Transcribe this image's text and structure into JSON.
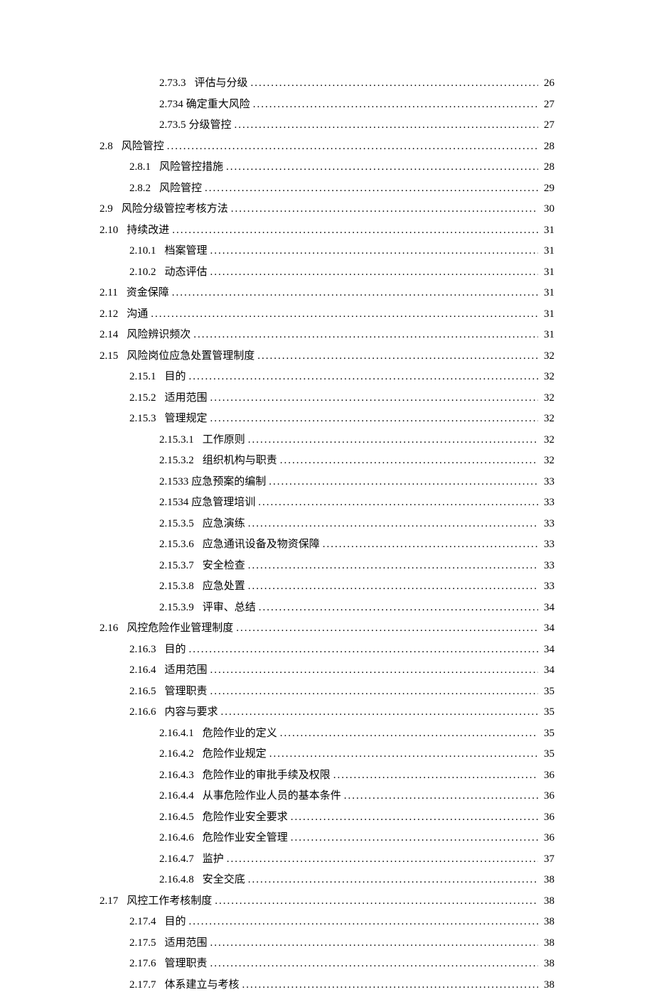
{
  "toc": [
    {
      "indent": 2,
      "num": "2.73.3",
      "title": "评估与分级",
      "page": "26"
    },
    {
      "indent": 2,
      "num": "2.734",
      "title": "确定重大风险",
      "nospace": true,
      "page": "27"
    },
    {
      "indent": 2,
      "num": "2.73.5",
      "title": "分级管控",
      "nospace": true,
      "page": "27"
    },
    {
      "indent": 0,
      "num": "2.8",
      "title": "风险管控",
      "page": "28"
    },
    {
      "indent": 1,
      "num": "2.8.1",
      "title": "风险管控措施",
      "page": "28"
    },
    {
      "indent": 1,
      "num": "2.8.2",
      "title": "风险管控",
      "page": "29"
    },
    {
      "indent": 0,
      "num": "2.9",
      "title": "风险分级管控考核方法",
      "page": "30"
    },
    {
      "indent": 0,
      "num": "2.10",
      "title": "持续改进",
      "page": "31"
    },
    {
      "indent": 1,
      "num": "2.10.1",
      "title": "档案管理",
      "page": "31"
    },
    {
      "indent": 1,
      "num": "2.10.2",
      "title": "动态评估",
      "page": "31"
    },
    {
      "indent": 0,
      "num": "2.11",
      "title": "资金保障",
      "page": "31"
    },
    {
      "indent": 0,
      "num": "2.12",
      "title": "沟通",
      "page": "31"
    },
    {
      "indent": 0,
      "num": "2.14",
      "title": "风险辨识频次",
      "page": "31"
    },
    {
      "indent": 0,
      "num": "2.15",
      "title": "风险岗位应急处置管理制度",
      "page": "32"
    },
    {
      "indent": 1,
      "num": "2.15.1",
      "title": "目的",
      "page": "32"
    },
    {
      "indent": 1,
      "num": "2.15.2",
      "title": "适用范围",
      "page": "32"
    },
    {
      "indent": 1,
      "num": "2.15.3",
      "title": "管理规定",
      "page": "32"
    },
    {
      "indent": 2,
      "num": "2.15.3.1",
      "title": "工作原则",
      "page": "32"
    },
    {
      "indent": 2,
      "num": "2.15.3.2",
      "title": "组织机构与职责",
      "page": "32"
    },
    {
      "indent": 2,
      "num": "2.1533",
      "title": "应急预案的编制",
      "nospace": true,
      "page": "33"
    },
    {
      "indent": 2,
      "num": "2.1534",
      "title": "应急管理培训",
      "nospace": true,
      "page": "33"
    },
    {
      "indent": 2,
      "num": "2.15.3.5",
      "title": "应急演练",
      "page": "33"
    },
    {
      "indent": 2,
      "num": "2.15.3.6",
      "title": "应急通讯设备及物资保障",
      "page": "33"
    },
    {
      "indent": 2,
      "num": "2.15.3.7",
      "title": "安全检查",
      "page": "33"
    },
    {
      "indent": 2,
      "num": "2.15.3.8",
      "title": "应急处置",
      "page": "33"
    },
    {
      "indent": 2,
      "num": "2.15.3.9",
      "title": "评审、总结",
      "page": "34"
    },
    {
      "indent": 0,
      "num": "2.16",
      "title": "风控危险作业管理制度",
      "page": "34"
    },
    {
      "indent": 1,
      "num": "2.16.3",
      "title": "目的",
      "page": "34"
    },
    {
      "indent": 1,
      "num": "2.16.4",
      "title": "适用范围",
      "page": "34"
    },
    {
      "indent": 1,
      "num": "2.16.5",
      "title": "管理职责",
      "page": "35"
    },
    {
      "indent": 1,
      "num": "2.16.6",
      "title": "内容与要求",
      "page": "35"
    },
    {
      "indent": 2,
      "num": "2.16.4.1",
      "title": "危险作业的定义",
      "page": "35"
    },
    {
      "indent": 2,
      "num": "2.16.4.2",
      "title": "危险作业规定",
      "page": "35"
    },
    {
      "indent": 2,
      "num": "2.16.4.3",
      "title": "危险作业的审批手续及权限",
      "page": "36"
    },
    {
      "indent": 2,
      "num": "2.16.4.4",
      "title": "从事危险作业人员的基本条件",
      "page": "36"
    },
    {
      "indent": 2,
      "num": "2.16.4.5",
      "title": "危险作业安全要求",
      "page": "36"
    },
    {
      "indent": 2,
      "num": "2.16.4.6",
      "title": "危险作业安全管理",
      "page": "36"
    },
    {
      "indent": 2,
      "num": "2.16.4.7",
      "title": "监护",
      "page": "37"
    },
    {
      "indent": 2,
      "num": "2.16.4.8",
      "title": "安全交底",
      "page": "38"
    },
    {
      "indent": 0,
      "num": "2.17",
      "title": "风控工作考核制度",
      "page": "38"
    },
    {
      "indent": 1,
      "num": "2.17.4",
      "title": "目的",
      "page": "38"
    },
    {
      "indent": 1,
      "num": "2.17.5",
      "title": "适用范围",
      "page": "38"
    },
    {
      "indent": 1,
      "num": "2.17.6",
      "title": "管理职责",
      "page": "38"
    },
    {
      "indent": 1,
      "num": "2.17.7",
      "title": "体系建立与考核",
      "page": "38"
    }
  ]
}
